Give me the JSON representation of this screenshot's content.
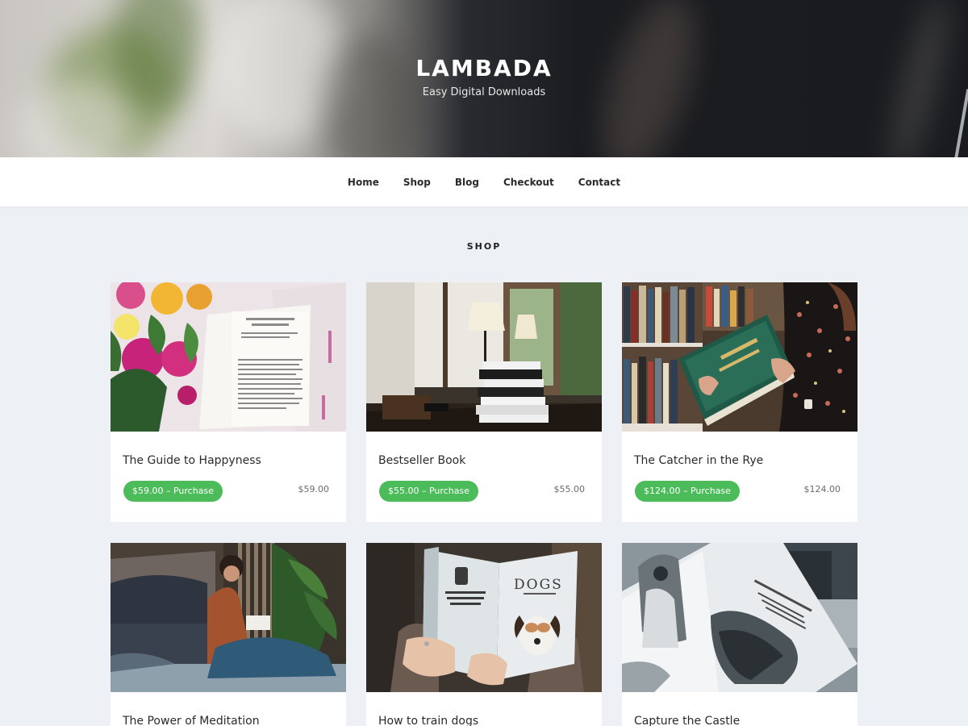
{
  "site": {
    "title": "LAMBADA",
    "tagline": "Easy Digital Downloads"
  },
  "nav": {
    "items": [
      {
        "label": "Home"
      },
      {
        "label": "Shop"
      },
      {
        "label": "Blog"
      },
      {
        "label": "Checkout"
      },
      {
        "label": "Contact"
      }
    ]
  },
  "shop": {
    "heading": "SHOP",
    "products": [
      {
        "title": "The Guide to Happyness",
        "button": "$59.00 – Purchase",
        "price": "$59.00",
        "image": "open-book-with-flowers"
      },
      {
        "title": "Bestseller Book",
        "button": "$55.00 – Purchase",
        "price": "$55.00",
        "image": "stack-of-books-with-lamp"
      },
      {
        "title": "The Catcher in the Rye",
        "button": "$124.00 – Purchase",
        "price": "$124.00",
        "image": "woman-holding-green-book"
      },
      {
        "title": "The Power of Meditation",
        "image": "woman-reading-on-floor"
      },
      {
        "title": "How to train dogs",
        "image": "person-reading-dogs-book"
      },
      {
        "title": "Capture the Castle",
        "image": "open-magazine-black-white"
      }
    ]
  },
  "colors": {
    "accent": "#4cbb5a",
    "page_bg": "#edf0f4",
    "hero_dark": "#1b1c20"
  }
}
